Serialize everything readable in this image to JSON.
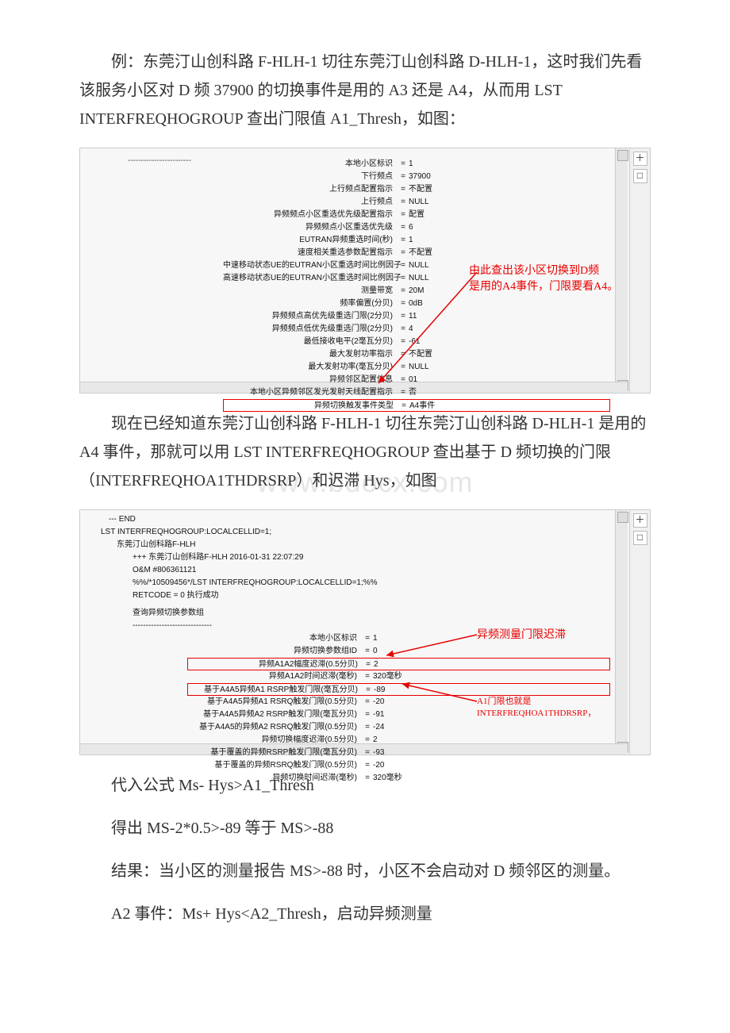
{
  "paragraphs": {
    "p1": "例：东莞汀山创科路 F-HLH-1 切往东莞汀山创科路 D-HLH-1，这时我们先看该服务小区对 D 频 37900 的切换事件是用的 A3 还是 A4，从而用 LST INTERFREQHOGROUP 查出门限值 A1_Thresh，如图：",
    "p2": "现在已经知道东莞汀山创科路 F-HLH-1 切往东莞汀山创科路 D-HLH-1 是用的 A4 事件，那就可以用 LST INTERFREQHOGROUP 查出基于 D 频切换的门限（INTERFREQHOA1THDRSRP）和迟滞 Hys，如图",
    "p3": "代入公式 Ms- Hys>A1_Thresh",
    "p4": "得出 MS-2*0.5>-89 等于 MS>-88",
    "p5": "结果：当小区的测量报告 MS>-88 时，小区不会启动对 D 频邻区的测量。",
    "p6": "A2 事件：Ms+ Hys<A2_Thresh，启动异频测量"
  },
  "screenshot1": {
    "separator": "------------------------",
    "rows": [
      {
        "label": "本地小区标识",
        "val": "1"
      },
      {
        "label": "下行频点",
        "val": "37900"
      },
      {
        "label": "上行频点配置指示",
        "val": "不配置"
      },
      {
        "label": "上行频点",
        "val": "NULL"
      },
      {
        "label": "异频频点小区重选优先级配置指示",
        "val": "配置"
      },
      {
        "label": "异频频点小区重选优先级",
        "val": "6"
      },
      {
        "label": "EUTRAN异频重选时间(秒)",
        "val": "1"
      },
      {
        "label": "速度相关重选参数配置指示",
        "val": "不配置"
      },
      {
        "label": "中速移动状态UE的EUTRAN小区重选时间比例因子",
        "val": "NULL"
      },
      {
        "label": "高速移动状态UE的EUTRAN小区重选时间比例因子",
        "val": "NULL"
      },
      {
        "label": "测量带宽",
        "val": "20M"
      },
      {
        "label": "频率偏置(分贝)",
        "val": "0dB"
      },
      {
        "label": "异频频点高优先级重选门限(2分贝)",
        "val": "11"
      },
      {
        "label": "异频频点低优先级重选门限(2分贝)",
        "val": "4"
      },
      {
        "label": "最低接收电平(2毫瓦分贝)",
        "val": "-61"
      },
      {
        "label": "最大发射功率指示",
        "val": "不配置"
      },
      {
        "label": "最大发射功率(毫瓦分贝)",
        "val": "NULL"
      },
      {
        "label": "异频邻区配置信息",
        "val": "01"
      },
      {
        "label": "本地小区异频邻区发光发射天线配置指示",
        "val": "否"
      },
      {
        "label": "异频切换触发事件类型",
        "val": "A4事件",
        "highlight": true
      }
    ],
    "annotation": {
      "line1": "由此查出该小区切换到D频",
      "line2": "是用的A4事件，门限要看A4。"
    }
  },
  "screenshot2": {
    "header": {
      "end": "---    END",
      "cmd": "LST INTERFREQHOGROUP:LOCALCELLID=1;",
      "site": "东莞汀山创科路F-HLH",
      "plus": "+++    东莞汀山创科路F-HLH        2016-01-31 22:07:29",
      "oam": "O&M    #806361121",
      "pct": "%%/*10509456*/LST INTERFREQHOGROUP:LOCALCELLID=1;%%",
      "ret": "RETCODE = 0  执行成功",
      "section": "查询异频切换参数组",
      "dash": "------------------------------"
    },
    "rows": [
      {
        "label": "本地小区标识",
        "val": "1"
      },
      {
        "label": "异频切换参数组ID",
        "val": "0"
      },
      {
        "label": "异频A1A2幅度迟滞(0.5分贝)",
        "val": "2",
        "highlight": true
      },
      {
        "label": "异频A1A2时间迟滞(毫秒)",
        "val": "320毫秒"
      },
      {
        "label": "基于A4A5异频A1 RSRP触发门限(毫瓦分贝)",
        "val": "-89",
        "highlight": true
      },
      {
        "label": "基于A4A5异频A1 RSRQ触发门限(0.5分贝)",
        "val": "-20"
      },
      {
        "label": "基于A4A5异频A2 RSRP触发门限(毫瓦分贝)",
        "val": "-91"
      },
      {
        "label": "基于A4A5的异频A2 RSRQ触发门限(0.5分贝)",
        "val": "-24"
      },
      {
        "label": "异频切换幅度迟滞(0.5分贝)",
        "val": "2"
      },
      {
        "label": "基于覆盖的异频RSRP触发门限(毫瓦分贝)",
        "val": "-93"
      },
      {
        "label": "基于覆盖的异频RSRQ触发门限(0.5分贝)",
        "val": "-20"
      },
      {
        "label": "异频切换时间迟滞(毫秒)",
        "val": "320毫秒"
      }
    ],
    "annotation": {
      "ann1": "异频测量门限迟滞",
      "ann2": "A1门限也就是INTERFREQHOA1THDRSRP，"
    }
  },
  "watermark": "www.bdocx.com",
  "toolstrip": {
    "icon1": "＋",
    "icon2": "□"
  }
}
